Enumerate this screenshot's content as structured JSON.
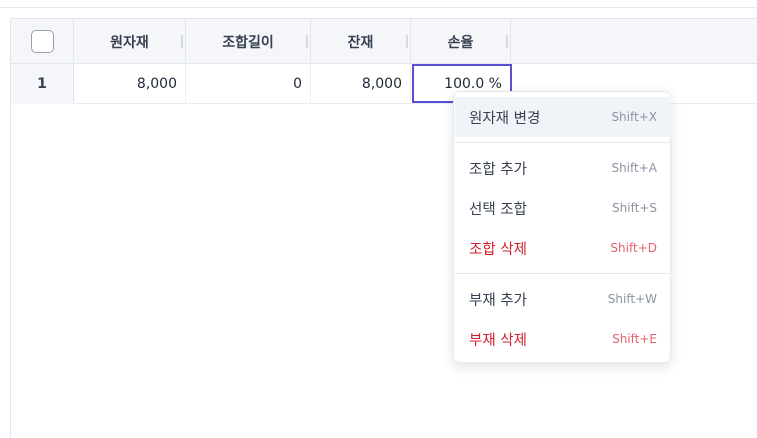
{
  "grid": {
    "columns": [
      {
        "key": "select",
        "label": ""
      },
      {
        "key": "raw_material",
        "label": "원자재"
      },
      {
        "key": "combined_length",
        "label": "조합길이"
      },
      {
        "key": "remainder",
        "label": "잔재"
      },
      {
        "key": "loss_rate",
        "label": "손율"
      }
    ],
    "rows": [
      {
        "index": "1",
        "raw_material": "8,000",
        "combined_length": "0",
        "remainder": "8,000",
        "loss_rate": "100.0 %"
      }
    ]
  },
  "context_menu": {
    "groups": [
      [
        {
          "label": "원자재 변경",
          "shortcut": "Shift+X",
          "danger": false
        }
      ],
      [
        {
          "label": "조합 추가",
          "shortcut": "Shift+A",
          "danger": false
        },
        {
          "label": "선택 조합",
          "shortcut": "Shift+S",
          "danger": false
        },
        {
          "label": "조합 삭제",
          "shortcut": "Shift+D",
          "danger": true
        }
      ],
      [
        {
          "label": "부재 추가",
          "shortcut": "Shift+W",
          "danger": false
        },
        {
          "label": "부재 삭제",
          "shortcut": "Shift+E",
          "danger": true
        }
      ]
    ]
  },
  "colors": {
    "selection_border": "#5b4fd6",
    "danger_text": "#d11f2c"
  }
}
